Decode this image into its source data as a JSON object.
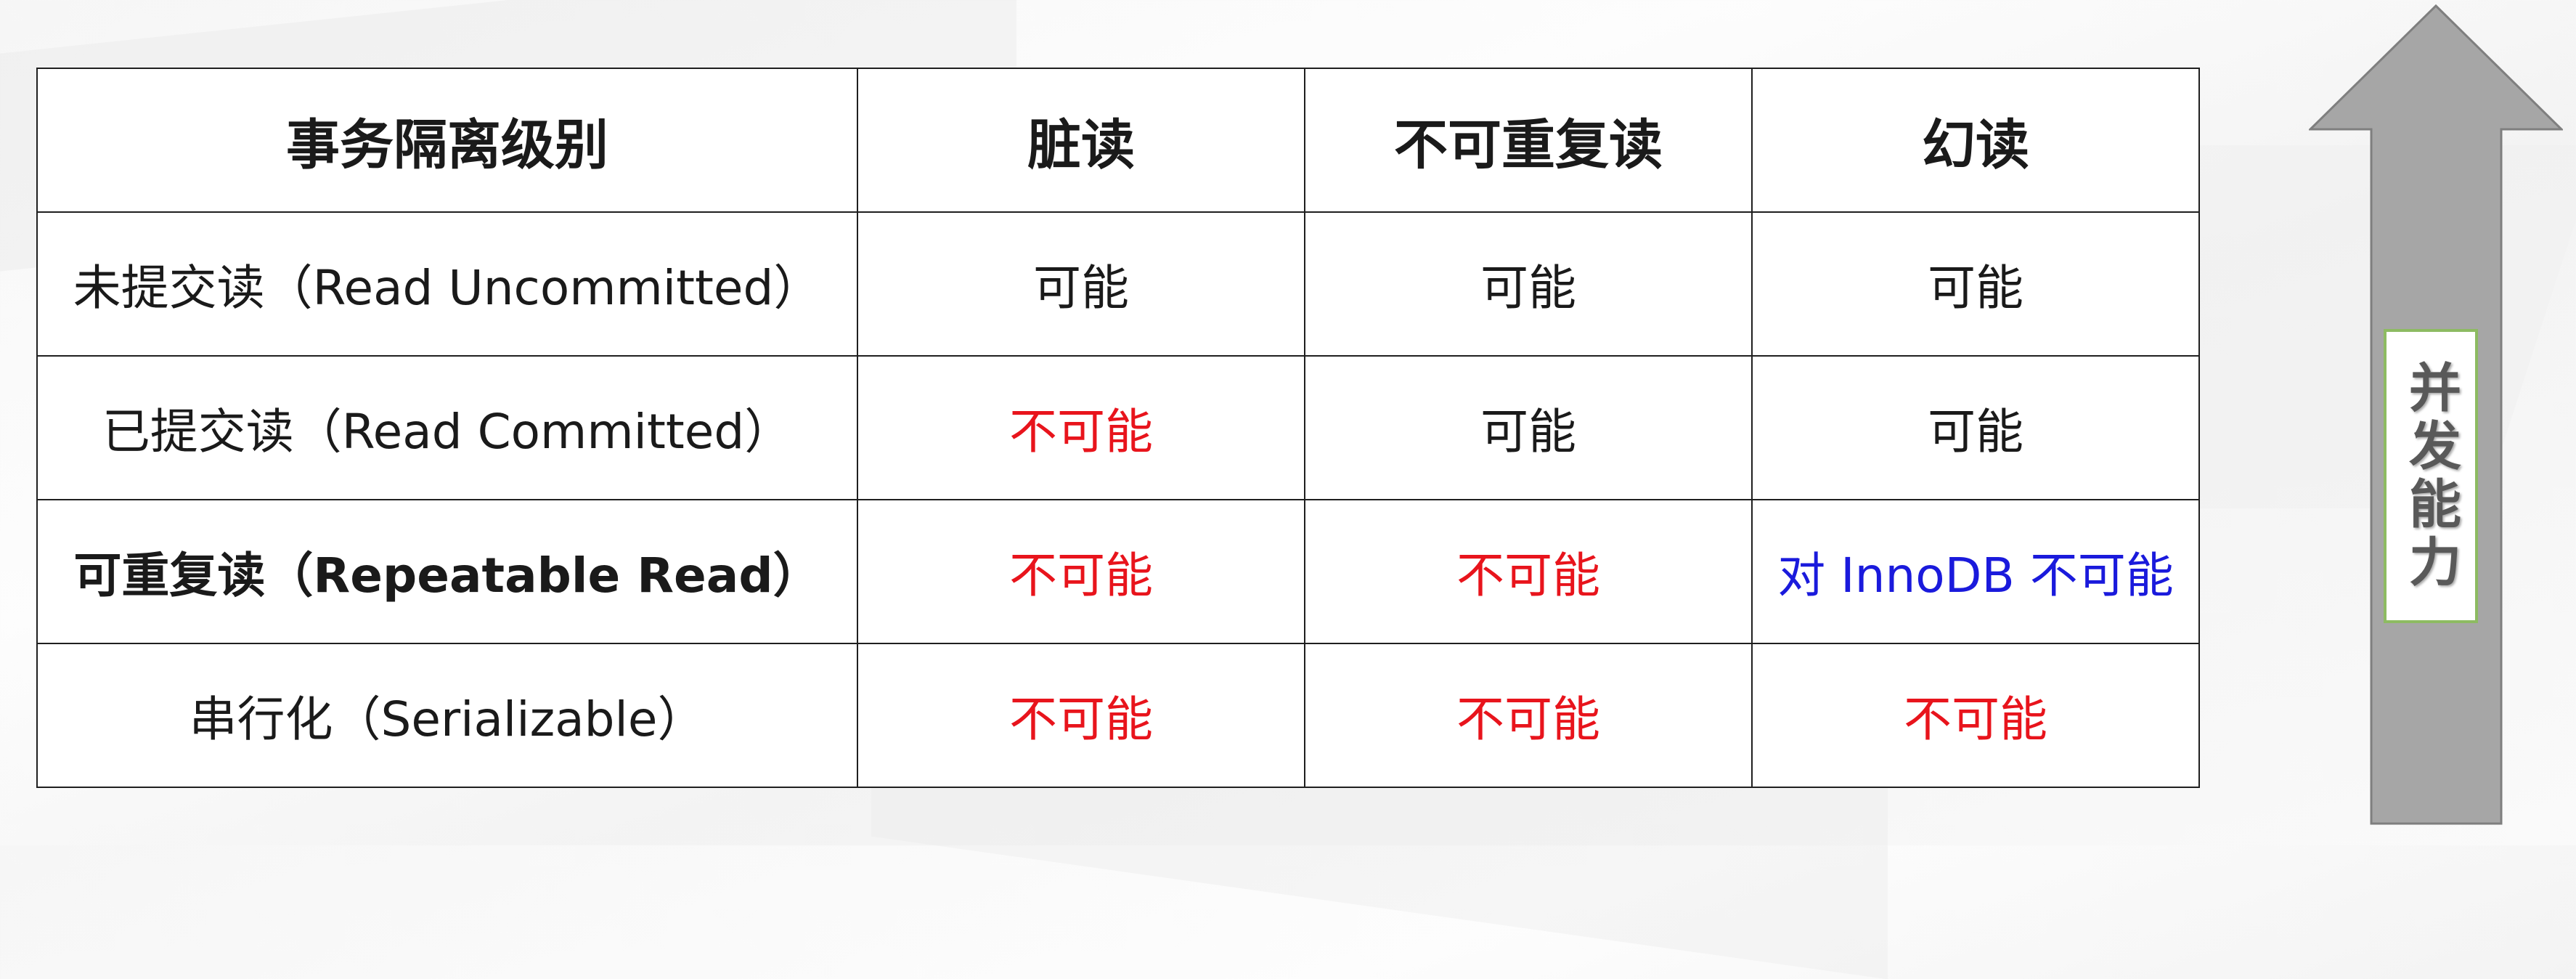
{
  "table": {
    "headers": {
      "level": "事务隔离级别",
      "dirty_read": "脏读",
      "non_repeatable_read": "不可重复读",
      "phantom_read": "幻读"
    },
    "rows": [
      {
        "level": "未提交读（Read Uncommitted）",
        "dirty_read": "可能",
        "non_repeatable_read": "可能",
        "phantom_read": "可能"
      },
      {
        "level": "已提交读（Read Committed）",
        "dirty_read": "不可能",
        "non_repeatable_read": "可能",
        "phantom_read": "可能"
      },
      {
        "level": "可重复读（Repeatable Read）",
        "dirty_read": "不可能",
        "non_repeatable_read": "不可能",
        "phantom_read": "对 InnoDB 不可能"
      },
      {
        "level": "串行化（Serializable）",
        "dirty_read": "不可能",
        "non_repeatable_read": "不可能",
        "phantom_read": "不可能"
      }
    ]
  },
  "arrow": {
    "label": "并发能力"
  },
  "colors": {
    "default_text": "#1a1a1a",
    "impossible_text": "#e8141c",
    "innodb_text": "#1a1adc",
    "arrow_fill": "#a6a6a6",
    "arrow_stroke": "#7f7f7f",
    "label_border": "#8dbb62",
    "label_text": "#595959"
  }
}
